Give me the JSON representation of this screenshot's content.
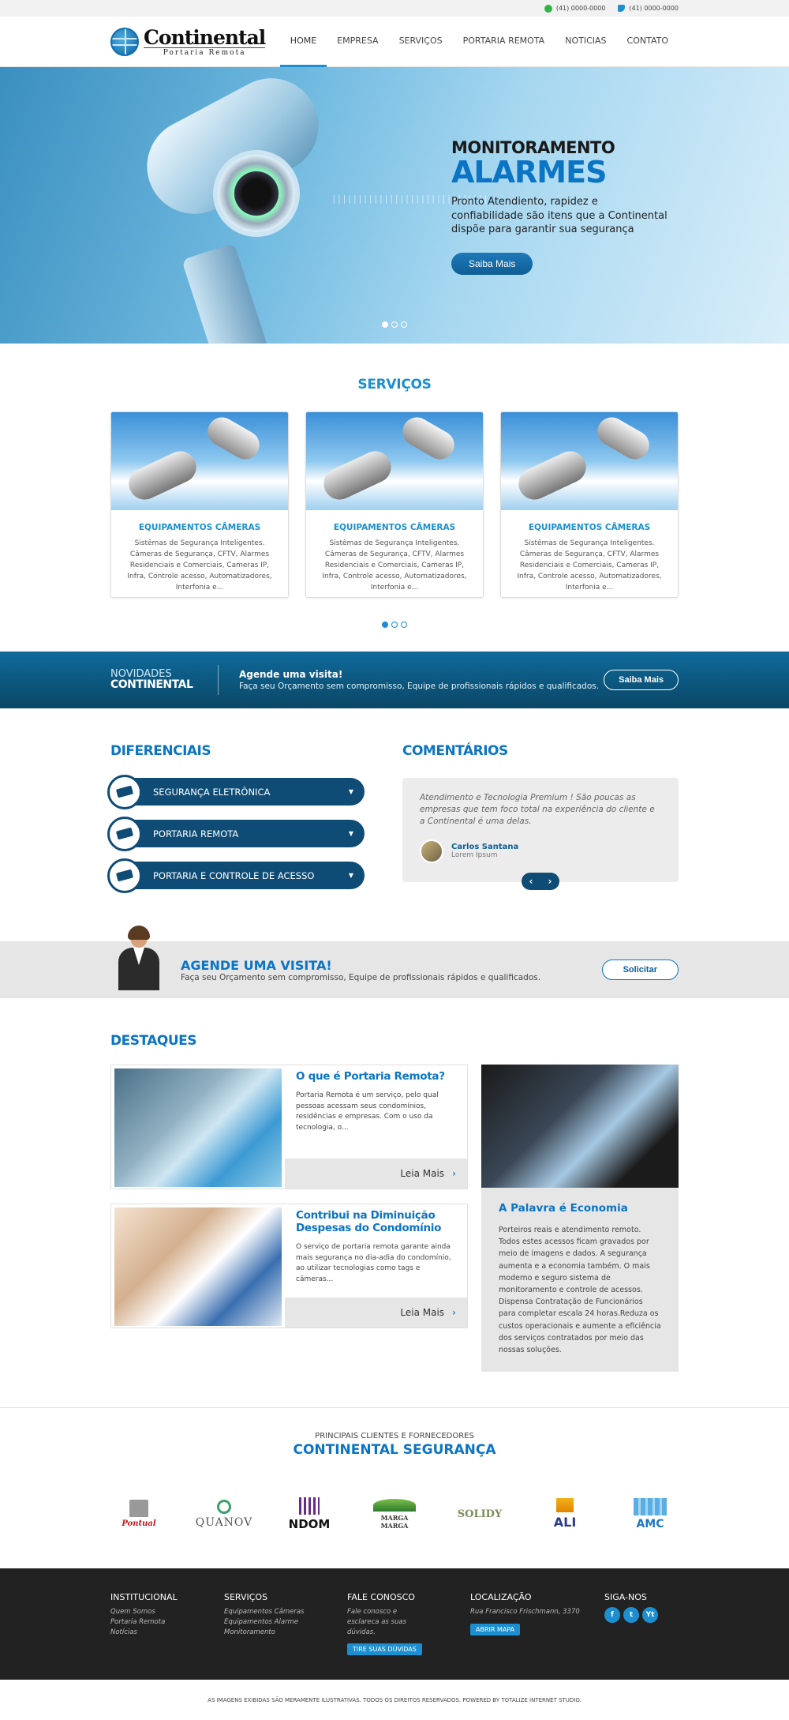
{
  "topbar": {
    "phone1": "(41) 0000-0000",
    "phone2": "(41) 0000-0000"
  },
  "brand": {
    "name": "Continental",
    "tagline": "Portaria Remota"
  },
  "nav": [
    "HOME",
    "EMPRESA",
    "SERVIÇOS",
    "PORTARIA REMOTA",
    "NOTICIAS",
    "CONTATO"
  ],
  "hero": {
    "kicker": "MONITORAMENTO",
    "title": "ALARMES",
    "desc": "Pronto Atendiento, rapidez e confiabilidade são itens que a Continental dispõe para garantir sua segurança",
    "button": "Saiba Mais",
    "deco": "||||||||||||||||||||||||||||||"
  },
  "servicos": {
    "title": "SERVIÇOS",
    "cards": [
      {
        "title": "EQUIPAMENTOS CÂMERAS",
        "desc": "Sistêmas de Segurança Inteligentes. Câmeras de Segurança, CFTV, Alarmes Residenciais e Comerciais, Cameras IP, Infra, Controle acesso, Automatizadores, Interfonia e..."
      },
      {
        "title": "EQUIPAMENTOS CÂMERAS",
        "desc": "Sistêmas de Segurança Inteligentes. Câmeras de Segurança, CFTV, Alarmes Residenciais e Comerciais, Cameras IP, Infra, Controle acesso, Automatizadores, Interfonia e..."
      },
      {
        "title": "EQUIPAMENTOS CÂMERAS",
        "desc": "Sistêmas de Segurança Inteligentes. Câmeras de Segurança, CFTV, Alarmes Residenciais e Comerciais, Cameras IP, Infra, Controle acesso, Automatizadores, Interfonia e..."
      }
    ]
  },
  "band": {
    "nov1": "NOVIDADES",
    "nov2": "CONTINENTAL",
    "head": "Agende uma visita!",
    "sub": "Faça seu Orçamento sem compromisso, Equipe de profissionais rápidos e qualificados.",
    "button": "Saiba Mais"
  },
  "diferenciais": {
    "title": "DIFERENCIAIS",
    "items": [
      "SEGURANÇA ELETRÔNICA",
      "PORTARIA REMOTA",
      "PORTARIA E CONTROLE DE ACESSO"
    ]
  },
  "comentarios": {
    "title": "COMENTÁRIOS",
    "quote": "Atendimento e Tecnologia Premium ! São poucas as empresas que tem foco total na experiência do cliente e a Continental é uma delas.",
    "author": "Carlos Santana",
    "role": "Lorem Ipsum"
  },
  "agende": {
    "head": "AGENDE UMA VISITA!",
    "sub": "Faça seu Orçamento sem compromisso, Equipe de profissionais rápidos e qualificados.",
    "button": "Solicitar"
  },
  "destaques": {
    "title": "DESTAQUES",
    "posts": [
      {
        "title": "O que é Portaria Remota?",
        "desc": "Portaria Remota é um serviço, pelo qual pessoas acessam seus condomínios, residências e empresas. Com o uso da tecnologia, o...",
        "more": "Leia Mais"
      },
      {
        "title": "Contribui na Diminuição Despesas do Condomínio",
        "desc": "O serviço de portaria remota garante ainda mais segurança no dia-adia do condomínio, ao utilizar tecnologias como tags e câmeras...",
        "more": "Leia Mais"
      }
    ],
    "side": {
      "title": "A Palavra é Economia",
      "desc": "Porteiros reais e atendimento remoto. Todos estes acessos ficam gravados por meio de imagens e dados. A segurança aumenta e a economia também. O mais moderno e seguro sistema de monitoramento e controle de acessos. Dispensa Contratação de Funcionários para completar escala 24 horas.Reduza os custos operacionais e aumente a eficiência dos serviços contratados por meio das nossas soluções."
    }
  },
  "clientes": {
    "kicker": "PRINCIPAIS CLIENTES E FORNECEDORES",
    "title": "CONTINENTAL SEGURANÇA",
    "logos": [
      "Pontual",
      "QUANOV",
      "NDOM",
      "MARGA MARGA",
      "SOLIDY",
      "ALI",
      "AMC"
    ]
  },
  "footer": {
    "institucional": {
      "title": "INSTITUCIONAL",
      "links": [
        "Quem Somos",
        "Portaria Remota",
        "Notícias"
      ]
    },
    "servicos": {
      "title": "SERVIÇOS",
      "links": [
        "Equipamentos Câmeras",
        "Equipamentos Alarme",
        "Monitoramento"
      ]
    },
    "fale": {
      "title": "FALE CONOSCO",
      "text": "Fale conosco e esclareca as suas dúvidas.",
      "button": "TIRE SUAS DÚVIDAS"
    },
    "local": {
      "title": "LOCALIZAÇÃO",
      "text": "Rua Francisco Frischmann, 3370",
      "button": "ABRIR MAPA"
    },
    "siga": {
      "title": "SIGA-NOS",
      "icons": [
        "f",
        "t",
        "Yt"
      ]
    },
    "copyright": "AS IMAGENS EXIBIDAS SÃO MERAMENTE ILUSTRATIVAS. TODOS OS DIREITOS RESERVADOS. POWERED BY TOTALIZE INTERNET STUDIO."
  },
  "colors": {
    "primary": "#1b8fd1",
    "dark": "#0f4c75",
    "footer": "#222222"
  }
}
